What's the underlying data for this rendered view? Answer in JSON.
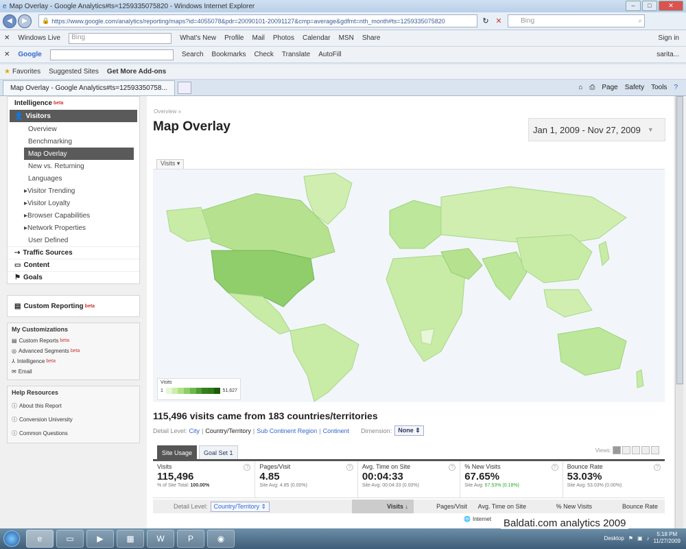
{
  "window": {
    "title": "Map Overlay - Google Analytics#ts=1259335075820 - Windows Internet Explorer",
    "url": "https://www.google.com/analytics/reporting/maps?id=4055078&pdr=20090101-20091127&cmp=average&gdfmt=nth_month#ts=1259335075820",
    "search_placeholder": "Bing"
  },
  "toolbar1": {
    "brand": "Windows Live",
    "search": "Bing",
    "links": [
      "What's New",
      "Profile",
      "Mail",
      "Photos",
      "Calendar",
      "MSN",
      "Share"
    ],
    "signin": "Sign in"
  },
  "toolbar2": {
    "brand": "Google",
    "items": [
      "Search",
      "Bookmarks",
      "Check",
      "Translate",
      "AutoFill"
    ],
    "user": "sarita..."
  },
  "favorites": {
    "label": "Favorites",
    "items": [
      "Suggested Sites",
      "Get More Add-ons"
    ]
  },
  "tab": {
    "label": "Map Overlay - Google Analytics#ts=12593350758...",
    "commands": [
      "Page",
      "Safety",
      "Tools"
    ]
  },
  "sidebar": {
    "intelligence": "Intelligence",
    "visitors": "Visitors",
    "visitor_items": [
      "Overview",
      "Benchmarking",
      "Map Overlay",
      "New vs. Returning",
      "Languages"
    ],
    "visitor_groups": [
      "Visitor Trending",
      "Visitor Loyalty",
      "Browser Capabilities",
      "Network Properties"
    ],
    "user_defined": "User Defined",
    "traffic": "Traffic Sources",
    "content": "Content",
    "goals": "Goals",
    "custom_reporting": "Custom Reporting",
    "new_badge": "beta",
    "my_custom_title": "My Customizations",
    "my_custom": [
      "Custom Reports",
      "Advanced Segments",
      "Intelligence",
      "Email"
    ],
    "help_title": "Help Resources",
    "help": [
      "About this Report",
      "Conversion University",
      "Common Questions"
    ]
  },
  "main": {
    "breadcrumb": "Overview »",
    "title": "Map Overlay",
    "date_range": "Jan 1, 2009 - Nov 27, 2009",
    "map_metric": "Visits",
    "legend": {
      "label": "Visits",
      "min": "1",
      "max": "51,627"
    },
    "summary": "115,496 visits came from 183 countries/territories",
    "detail_label": "Detail Level:",
    "detail_options": [
      "City",
      "Country/Territory",
      "Sub Continent Region",
      "Continent"
    ],
    "dimension_label": "Dimension:",
    "dimension_value": "None",
    "tabs": [
      "Site Usage",
      "Goal Set 1"
    ],
    "views_label": "Views:",
    "metrics": [
      {
        "name": "Visits",
        "value": "115,496",
        "sub_label": "% of Site Total:",
        "sub_value": "100.00%"
      },
      {
        "name": "Pages/Visit",
        "value": "4.85",
        "sub_label": "Site Avg:",
        "sub_value": "4.85 (0.00%)"
      },
      {
        "name": "Avg. Time on Site",
        "value": "00:04:33",
        "sub_label": "Site Avg:",
        "sub_value": "00:04:33 (0.00%)"
      },
      {
        "name": "% New Visits",
        "value": "67.65%",
        "sub_label": "Site Avg:",
        "sub_value": "67.53% (0.18%)"
      },
      {
        "name": "Bounce Rate",
        "value": "53.03%",
        "sub_label": "Site Avg:",
        "sub_value": "53.03% (0.00%)"
      }
    ],
    "table_detail_label": "Detail Level:",
    "table_detail_value": "Country/Territory",
    "columns": [
      "Visits",
      "Pages/Visit",
      "Avg. Time on Site",
      "% New Visits",
      "Bounce Rate"
    ]
  },
  "status": {
    "zone": "Internet"
  },
  "taskbar": {
    "desktop": "Desktop",
    "time": "5:18 PM",
    "date": "11/27/2009"
  },
  "watermark": "Baldati.com analytics 2009",
  "colors": {
    "accent": "#3366cc",
    "map_land": "#c8eba5",
    "map_us": "#8fce6a",
    "legend_dark": "#2d7a16"
  }
}
